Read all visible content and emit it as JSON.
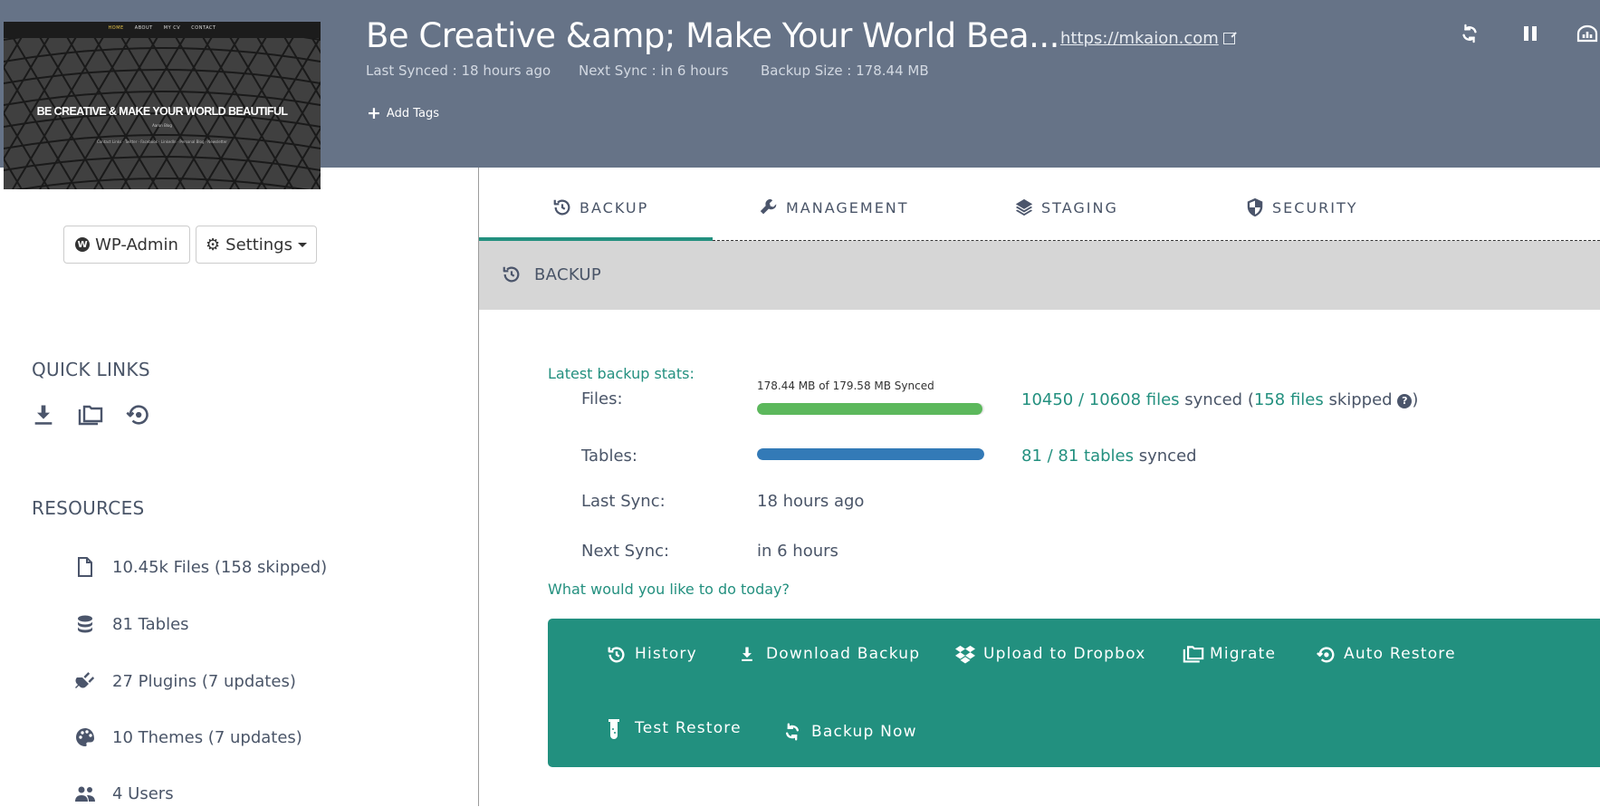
{
  "header": {
    "thumbnail": {
      "nav": [
        "HOME",
        "ABOUT",
        "MY CV",
        "CONTACT"
      ],
      "hero_text": "BE CREATIVE & MAKE YOUR WORLD BEAUTIFUL",
      "sub_text": "Aaron Blog",
      "social_text": "Contact Links  ·  Twitter  ·  Facebook  ·  LinkedIn  ·  Personal Blog  ·  Newsletter"
    },
    "site_title": "Be Creative &amp; Make Your World Bea...",
    "site_url": "https://mkaion.com",
    "last_synced": "Last Synced : 18 hours ago",
    "next_sync": "Next Sync : in 6 hours",
    "backup_size": "Backup Size : 178.44 MB",
    "add_tags_label": "Add Tags",
    "icons": [
      "sync-icon",
      "pause-icon",
      "dashboard-icon"
    ]
  },
  "sidebar": {
    "wp_admin_label": "WP-Admin",
    "settings_label": "Settings",
    "quick_links_title": "QUICK LINKS",
    "quick_links": [
      "download-icon",
      "folders-icon",
      "restore-icon"
    ],
    "resources_title": "RESOURCES",
    "resources": [
      {
        "icon": "file-icon",
        "label": "10.45k Files (158 skipped)"
      },
      {
        "icon": "database-icon",
        "label": "81 Tables"
      },
      {
        "icon": "plug-icon",
        "label": "27 Plugins (7 updates)"
      },
      {
        "icon": "palette-icon",
        "label": "10 Themes (7 updates)"
      },
      {
        "icon": "users-icon",
        "label": "4 Users"
      }
    ]
  },
  "tabs": [
    {
      "label": "BACKUP",
      "icon": "history-icon",
      "active": true
    },
    {
      "label": "MANAGEMENT",
      "icon": "wrench-icon",
      "active": false
    },
    {
      "label": "STAGING",
      "icon": "layers-icon",
      "active": false
    },
    {
      "label": "SECURITY",
      "icon": "shield-icon",
      "active": false
    }
  ],
  "section_title": "BACKUP",
  "stats": {
    "heading": "Latest backup stats:",
    "files_label": "Files:",
    "files_caption": "178.44 MB of 179.58 MB Synced",
    "files_progress_percent": 99.4,
    "files_synced": "10450 / 10608 files",
    "files_synced_suffix": " synced (",
    "files_skipped": "158 files",
    "files_skipped_suffix": " skipped ",
    "files_close": ")",
    "tables_label": "Tables:",
    "tables_progress_percent": 100,
    "tables_synced": "81 / 81 tables",
    "tables_synced_suffix": " synced",
    "last_sync_label": "Last Sync:",
    "last_sync_value": "18 hours ago",
    "next_sync_label": "Next Sync:",
    "next_sync_value": "in 6 hours",
    "prompt": "What would you like to do today?"
  },
  "colors": {
    "header_bg": "#667387",
    "accent": "#23907f",
    "files_bar": "#5cb85c",
    "tables_bar": "#337ab7"
  },
  "actions": [
    {
      "label": "History",
      "icon": "history-icon"
    },
    {
      "label": "Download Backup",
      "icon": "download-icon"
    },
    {
      "label": "Upload to Dropbox",
      "icon": "dropbox-icon"
    },
    {
      "label": "Migrate",
      "icon": "folders-icon"
    },
    {
      "label": "Auto Restore",
      "icon": "restore-icon"
    },
    {
      "label": "Test Restore",
      "icon": "test-tube-icon"
    },
    {
      "label": "Backup Now",
      "icon": "sync-icon"
    }
  ]
}
